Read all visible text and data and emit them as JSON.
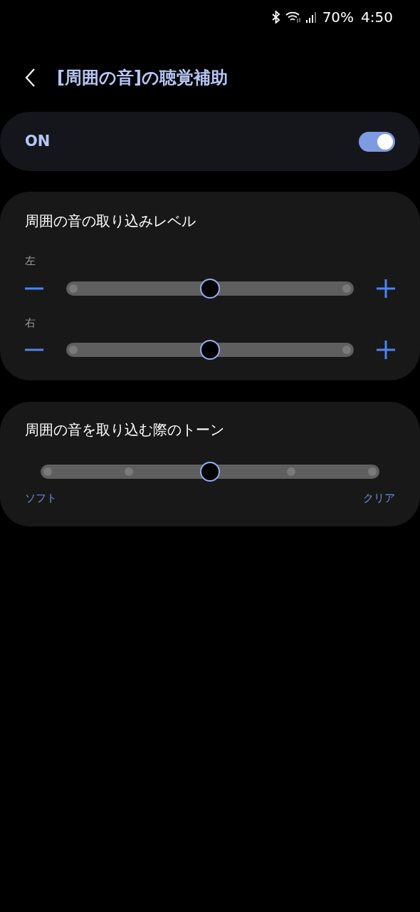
{
  "status_bar": {
    "battery": "70%",
    "time": "4:50"
  },
  "header": {
    "title": "[周囲の音]の聴覚補助"
  },
  "master_switch": {
    "label": "ON",
    "on": true
  },
  "level_card": {
    "title": "周囲の音の取り込みレベル",
    "channels": [
      {
        "label": "左",
        "level": 0.5,
        "kind": "continuous"
      },
      {
        "label": "右",
        "level": 0.5,
        "kind": "continuous"
      }
    ]
  },
  "tone_card": {
    "title": "周囲の音を取り込む際のトーン",
    "level": 0.5,
    "kind": "stepped",
    "min_label": "ソフト",
    "max_label": "クリア"
  }
}
